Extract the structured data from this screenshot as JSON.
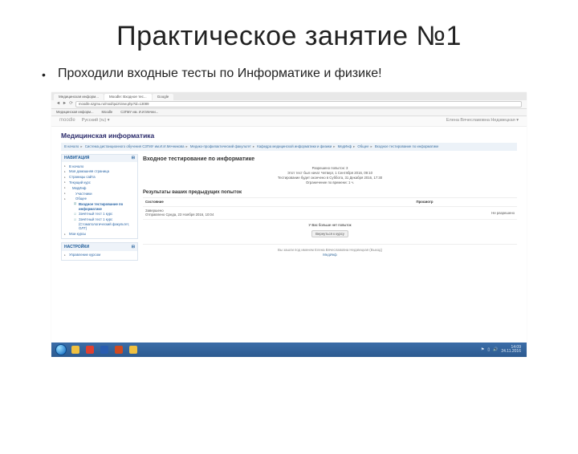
{
  "slide": {
    "title": "Практическое занятие №1",
    "bullet": "Проходили входные тесты по Информатике и физике!"
  },
  "browser": {
    "tabs": [
      "Медицинская информ...",
      "Moodle: Входное тес...",
      "Google"
    ],
    "url": "moodle.szgmu.ru/mod/quiz/view.php?id=13089",
    "bookmarks": [
      "Медицинская информ...",
      "Moodle",
      "СЗГМУ им. И.И.Мечни..."
    ]
  },
  "moodle": {
    "logo": "moodle",
    "lang": "Русский (ru)",
    "user": "Елена Вячеславовна Недзвецкая",
    "course_title": "Медицинская информатика",
    "breadcrumb": [
      "В начало",
      "Система дистанционного обучения СЗГМУ им.И.И.Мечникова",
      "Медико-профилактический факультет",
      "Кафедра медицинской информатики и физики",
      "МедИнф",
      "Общее",
      "Входное тестирование по информатике"
    ],
    "nav_block": {
      "title": "НАВИГАЦИЯ",
      "items": [
        "В начало",
        "Моя домашняя страница",
        "Страницы сайта",
        "Текущий курс"
      ],
      "course_node": "МедИнф",
      "course_children": [
        "Участники",
        "Общее"
      ],
      "quiz_items": [
        "Входное тестирование по информатике",
        "Зачётный тест 1 курс",
        "Зачётный тест 1 курс (Стоматологический факультет, ОЛТ)"
      ],
      "my_courses": "Мои курсы"
    },
    "settings_block": {
      "title": "НАСТРОЙКИ",
      "item": "Управление курсом"
    },
    "main": {
      "h2": "Входное тестирование по информатике",
      "meta": {
        "attempts_allowed": "Разрешено попыток: 3",
        "opened": "Этот тест был начат Четверг, 1 Сентября 2016, 09:10",
        "closes": "Тестирование будет окончено в Суббота, 31 Декабря 2016, 17:30",
        "limit": "Ограничение по времени: 1 ч."
      },
      "sub_h": "Результаты ваших предыдущих попыток",
      "table": {
        "col_state": "Состояние",
        "col_review": "Просмотр",
        "row_state": "Завершено",
        "row_sub": "Отправлено Среда, 23 Ноября 2016, 10:04",
        "row_review": "Не разрешено"
      },
      "no_more": "У Вас больше нет попыток",
      "back_btn": "Вернуться к курсу"
    },
    "footer": {
      "logged": "Вы зашли под именем Елена Вячеславовна Недзвецкая (Выход)",
      "home": "МедИнф"
    }
  },
  "taskbar": {
    "icons": [
      "explorer",
      "chrome",
      "word",
      "powerpoint",
      "folder"
    ],
    "colors": {
      "explorer": "#f0c040",
      "chrome": "#e04030",
      "word": "#2a5db0",
      "powerpoint": "#d04a20",
      "folder": "#f0c040"
    },
    "time": "14:09",
    "date": "24.11.2016"
  }
}
